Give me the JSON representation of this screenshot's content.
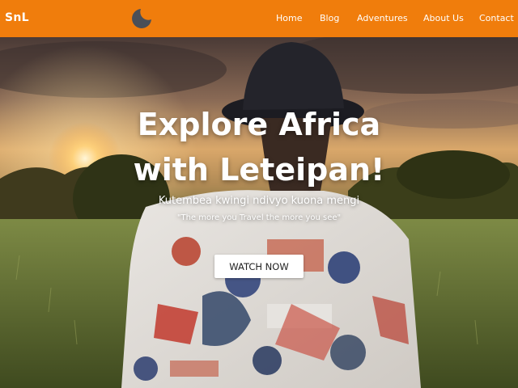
{
  "navbar": {
    "brand": "SnL",
    "theme_toggle_icon": "moon-icon",
    "links": [
      "Home",
      "Blog",
      "Adventures",
      "About Us",
      "Contact"
    ]
  },
  "hero": {
    "title_line1": "Explore Africa",
    "title_line2": "with Leteipan!",
    "subtitle": "Kutembea kwingi ndivyo kuona mengi",
    "quote": "\"The more you Travel the more you see\"",
    "cta_label": "WATCH NOW"
  },
  "colors": {
    "navbar_bg": "#f07d0c",
    "nav_text": "#ffffff",
    "moon": "#4a4f57",
    "cta_bg": "#ffffff"
  }
}
